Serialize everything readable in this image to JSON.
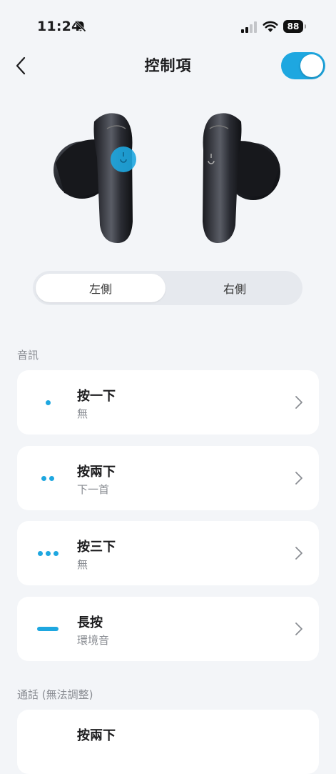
{
  "status_bar": {
    "time": "11:24",
    "battery": "88",
    "icons": [
      "bell-muted-icon",
      "cellular-signal-icon",
      "wifi-icon",
      "battery-icon"
    ]
  },
  "header": {
    "title": "控制項",
    "back_icon": "chevron-left-icon",
    "toggle_on": true
  },
  "colors": {
    "accent": "#1ea7e0",
    "background": "#f3f5f8",
    "card": "#ffffff",
    "secondary_text": "#8a8d93"
  },
  "segmented": {
    "left": "左側",
    "right": "右側",
    "selected": "left"
  },
  "sections": {
    "audio": "音訊",
    "calls": "通話 (無法調整)"
  },
  "controls": [
    {
      "icon": "single-dot-icon",
      "title": "按一下",
      "value": "無"
    },
    {
      "icon": "double-dot-icon",
      "title": "按兩下",
      "value": "下一首"
    },
    {
      "icon": "triple-dot-icon",
      "title": "按三下",
      "value": "無"
    },
    {
      "icon": "long-press-dash-icon",
      "title": "長按",
      "value": "環境音"
    }
  ],
  "call_controls": [
    {
      "title": "按兩下"
    }
  ]
}
